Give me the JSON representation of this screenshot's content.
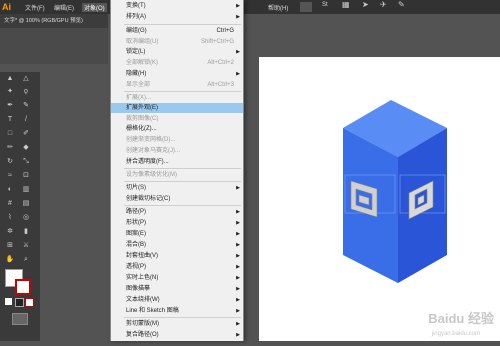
{
  "app": {
    "logo": "Ai"
  },
  "menubar": {
    "items": [
      "文件(F)",
      "编辑(E)",
      "对象(O)"
    ],
    "right_label": "帮助(H)"
  },
  "document_tab": {
    "title": "文字* @ 100% (RGB/GPU 预览)"
  },
  "menu": {
    "items": [
      {
        "label": "变换(T)",
        "shortcut": "",
        "submenu": true,
        "disabled": false
      },
      {
        "label": "排列(A)",
        "shortcut": "",
        "submenu": true,
        "disabled": false
      },
      {
        "label": "编组(G)",
        "shortcut": "Ctrl+G",
        "submenu": false,
        "disabled": false
      },
      {
        "label": "取消编组(U)",
        "shortcut": "Shift+Ctrl+G",
        "submenu": false,
        "disabled": false
      },
      {
        "label": "锁定(L)",
        "shortcut": "",
        "submenu": true,
        "disabled": false
      },
      {
        "label": "全部解锁(K)",
        "shortcut": "Alt+Ctrl+2",
        "submenu": false,
        "disabled": true
      },
      {
        "label": "隐藏(H)",
        "shortcut": "",
        "submenu": true,
        "disabled": false
      },
      {
        "label": "显示全部",
        "shortcut": "Alt+Ctrl+3",
        "submenu": false,
        "disabled": true
      },
      {
        "label": "扩展(X)...",
        "shortcut": "",
        "submenu": false,
        "disabled": true
      },
      {
        "label": "扩展外观(E)",
        "shortcut": "",
        "submenu": false,
        "disabled": false,
        "highlighted": true
      },
      {
        "label": "裁剪图像(C)",
        "shortcut": "",
        "submenu": false,
        "disabled": true
      },
      {
        "label": "栅格化(Z)...",
        "shortcut": "",
        "submenu": false,
        "disabled": false
      },
      {
        "label": "创建渐变网格(D)...",
        "shortcut": "",
        "submenu": false,
        "disabled": true
      },
      {
        "label": "创建对象马赛克(J)...",
        "shortcut": "",
        "submenu": false,
        "disabled": true
      },
      {
        "label": "拼合透明度(F)...",
        "shortcut": "",
        "submenu": false,
        "disabled": false
      },
      {
        "label": "设为像素级优化(M)",
        "shortcut": "",
        "submenu": false,
        "disabled": true
      },
      {
        "label": "切片(S)",
        "shortcut": "",
        "submenu": true,
        "disabled": false
      },
      {
        "label": "创建裁切标记(C)",
        "shortcut": "",
        "submenu": false,
        "disabled": false
      },
      {
        "label": "路径(P)",
        "shortcut": "",
        "submenu": true,
        "disabled": false
      },
      {
        "label": "形状(P)",
        "shortcut": "",
        "submenu": true,
        "disabled": false
      },
      {
        "label": "图案(E)",
        "shortcut": "",
        "submenu": true,
        "disabled": false
      },
      {
        "label": "混合(B)",
        "shortcut": "",
        "submenu": true,
        "disabled": false
      },
      {
        "label": "封套扭曲(V)",
        "shortcut": "",
        "submenu": true,
        "disabled": false
      },
      {
        "label": "透视(P)",
        "shortcut": "",
        "submenu": true,
        "disabled": false
      },
      {
        "label": "实时上色(N)",
        "shortcut": "",
        "submenu": true,
        "disabled": false
      },
      {
        "label": "图像描摹",
        "shortcut": "",
        "submenu": true,
        "disabled": false
      },
      {
        "label": "文本绕排(W)",
        "shortcut": "",
        "submenu": true,
        "disabled": false
      },
      {
        "label": "Line 和 Sketch 图稿",
        "shortcut": "",
        "submenu": true,
        "disabled": false
      },
      {
        "label": "剪切蒙版(M)",
        "shortcut": "",
        "submenu": true,
        "disabled": false
      },
      {
        "label": "复合路径(O)",
        "shortcut": "",
        "submenu": true,
        "disabled": false
      }
    ]
  },
  "colors": {
    "menu_highlight": "#9ac9f0",
    "cube_front": "#3a6de8",
    "cube_side": "#2a55d6",
    "cube_top": "#5a8cf5",
    "accent": "#ff9a00"
  },
  "watermark": {
    "text": "Baidu 经验",
    "url": "jingyan.baidu.com"
  }
}
